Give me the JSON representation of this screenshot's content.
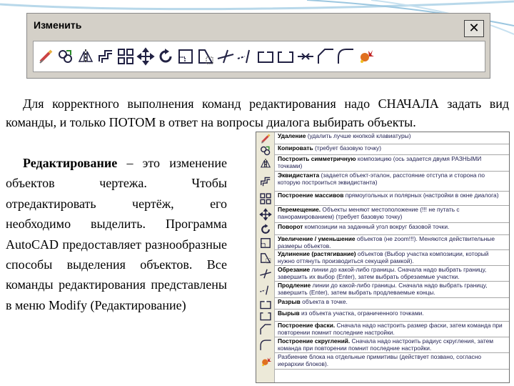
{
  "toolbar": {
    "title": "Изменить",
    "close_label": "✕",
    "icons": [
      "erase-icon",
      "copy-icon",
      "mirror-icon",
      "offset-icon",
      "array-icon",
      "move-icon",
      "rotate-icon",
      "scale-icon",
      "stretch-icon",
      "trim-icon",
      "extend-icon",
      "break-at-point-icon",
      "break-icon",
      "join-icon",
      "chamfer-icon",
      "fillet-icon",
      "explode-icon"
    ]
  },
  "intro": "Для корректного выполнения команд редактирования надо СНАЧАЛА задать вид команды, и только ПОТОМ в ответ на вопросы диалога выбирать объекты.",
  "body": {
    "term": "Редактирование",
    "text": " – это изменение объектов чертежа. Чтобы отредактировать чертёж, его необходимо выделить. Программа AutoCAD предоставляет разнообразные способы выделения объектов. Все команды редактирования представлены в меню Modify (Редактирование)"
  },
  "commands": [
    {
      "name": "Удаление",
      "desc": " (удалить лучше кнопкой клавиатуры)"
    },
    {
      "name": "Копировать",
      "desc": " (требует базовую точку)"
    },
    {
      "name": "Построить симметричную",
      "desc": " композицию (ось задается двумя РАЗНЫМИ точками)"
    },
    {
      "name": "Эквидистанта",
      "desc": " (задается объект-эталон, расстояние отступа и сторона по которую построиться эквидистанта)"
    },
    {
      "name": "Построение массивов",
      "desc": " прямоугольных и полярных (настройки в окне диалога)"
    },
    {
      "name": "Перемещение.",
      "desc": " Объекты меняют местоположение (!!! не путать с панорамированием) (требует базовую точку)"
    },
    {
      "name": "Поворот",
      "desc": " композиции на заданный угол вокруг базовой точки."
    },
    {
      "name": "Увеличение / уменьшение",
      "desc": " объектов (не zoom!!!). Меняются действительные размеры объектов."
    },
    {
      "name": "Удлинение (растягивание)",
      "desc": " объектов (Выбор участка композиции, который нужно оттянуть производиться секущей рамкой)."
    },
    {
      "name": "Обрезание",
      "desc": " линии до какой-либо границы. Сначала надо выбрать границу, завершить их выбор (Enter), затем выбрать обрезаемые участки."
    },
    {
      "name": "Продление",
      "desc": " линии до какой-либо границы. Сначала надо выбрать границу, завершить (Enter), затем выбрать продлеваемые концы."
    },
    {
      "name": "Разрыв",
      "desc": " объекта в точке."
    },
    {
      "name": "Вырыв",
      "desc": " из объекта участка, ограниченного точками."
    },
    {
      "name": "Построение фаски.",
      "desc": " Сначала надо настроить размер фаски, затем команда при повторении помнит последние настройки."
    },
    {
      "name": "Построение скруглений.",
      "desc": " Сначала надо настроить радиус скругления, затем команда при повторении помнит последние настройки."
    },
    {
      "name": "",
      "desc": "Разбиение блока на отдельные примитивы (действует позвано, согласно иерархии блоков)."
    }
  ]
}
